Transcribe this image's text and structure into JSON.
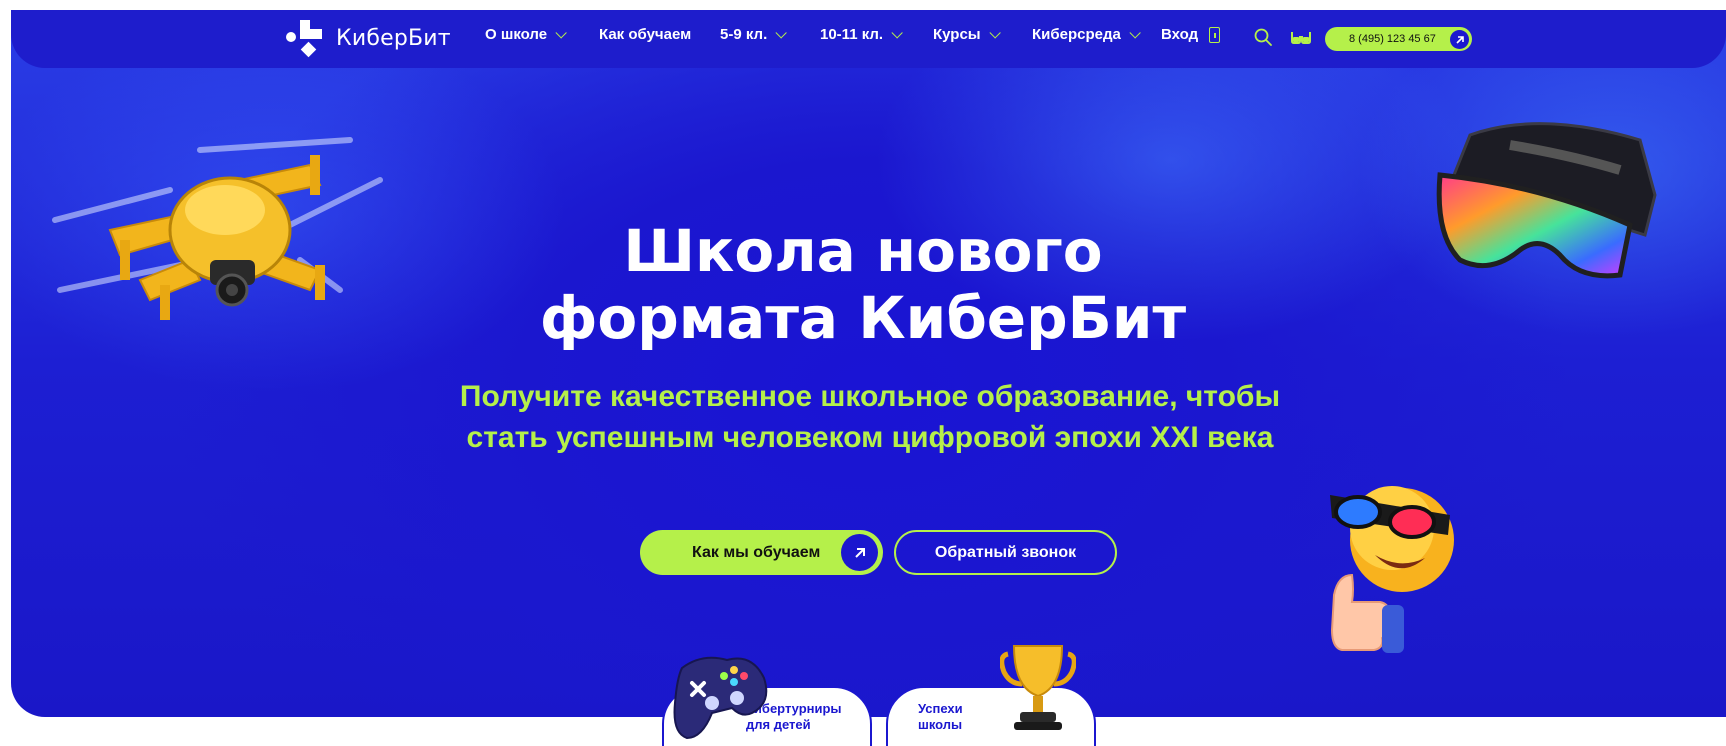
{
  "brand": {
    "name": "КиберБит"
  },
  "nav": {
    "items": [
      {
        "label": "О школе",
        "has_dropdown": true
      },
      {
        "label": "Как обучаем",
        "has_dropdown": false
      },
      {
        "label": "5-9 кл.",
        "has_dropdown": true
      },
      {
        "label": "10-11 кл.",
        "has_dropdown": true
      },
      {
        "label": "Курсы",
        "has_dropdown": true
      },
      {
        "label": "Киберсреда",
        "has_dropdown": true
      }
    ],
    "login_label": "Вход",
    "search_icon": "search-icon",
    "accessibility_icon": "glasses-icon",
    "phone": "8 (495) 123 45 67"
  },
  "hero": {
    "title_line1": "Школа нового",
    "title_line2": "формата КиберБит",
    "subtitle_line1": "Получите качественное школьное образование, чтобы",
    "subtitle_line2": "стать успешным человеком цифровой эпохи XXI века",
    "primary_button": "Как мы обучаем",
    "secondary_button": "Обратный звонок"
  },
  "cards": [
    {
      "line1": "Кибертурниры",
      "line2": "для детей",
      "icon": "gamepad-icon"
    },
    {
      "line1": "Успехи",
      "line2": "школы",
      "icon": "trophy-icon"
    }
  ],
  "colors": {
    "brand_blue": "#1b17cf",
    "accent_green": "#b5f04a",
    "white": "#ffffff"
  }
}
